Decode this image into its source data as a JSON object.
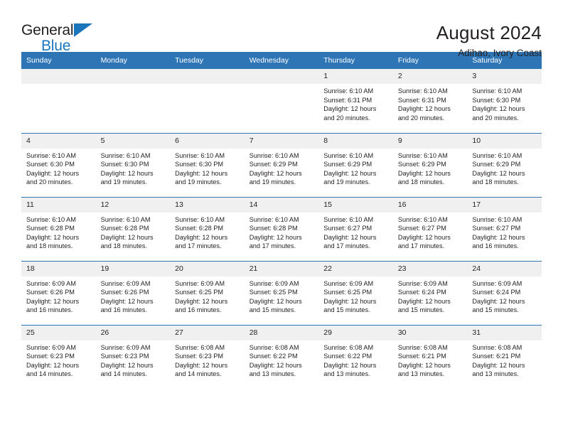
{
  "brand": {
    "name_part1": "General",
    "name_part2": "Blue",
    "triangle_icon": "triangle-icon",
    "accent_color": "#1b75bb"
  },
  "header": {
    "title": "August 2024",
    "location": "Adihao, Ivory Coast"
  },
  "calendar": {
    "header_bg": "#2e75b6",
    "daynum_bg": "#f0f0f0",
    "weekdays": [
      "Sunday",
      "Monday",
      "Tuesday",
      "Wednesday",
      "Thursday",
      "Friday",
      "Saturday"
    ],
    "labels": {
      "sunrise": "Sunrise:",
      "sunset": "Sunset:",
      "daylight": "Daylight:"
    },
    "weeks": [
      [
        {
          "day": "",
          "empty": true
        },
        {
          "day": "",
          "empty": true
        },
        {
          "day": "",
          "empty": true
        },
        {
          "day": "",
          "empty": true
        },
        {
          "day": "1",
          "sunrise": "Sunrise: 6:10 AM",
          "sunset": "Sunset: 6:31 PM",
          "daylight_1": "Daylight: 12 hours",
          "daylight_2": "and 20 minutes."
        },
        {
          "day": "2",
          "sunrise": "Sunrise: 6:10 AM",
          "sunset": "Sunset: 6:31 PM",
          "daylight_1": "Daylight: 12 hours",
          "daylight_2": "and 20 minutes."
        },
        {
          "day": "3",
          "sunrise": "Sunrise: 6:10 AM",
          "sunset": "Sunset: 6:30 PM",
          "daylight_1": "Daylight: 12 hours",
          "daylight_2": "and 20 minutes."
        }
      ],
      [
        {
          "day": "4",
          "sunrise": "Sunrise: 6:10 AM",
          "sunset": "Sunset: 6:30 PM",
          "daylight_1": "Daylight: 12 hours",
          "daylight_2": "and 20 minutes."
        },
        {
          "day": "5",
          "sunrise": "Sunrise: 6:10 AM",
          "sunset": "Sunset: 6:30 PM",
          "daylight_1": "Daylight: 12 hours",
          "daylight_2": "and 19 minutes."
        },
        {
          "day": "6",
          "sunrise": "Sunrise: 6:10 AM",
          "sunset": "Sunset: 6:30 PM",
          "daylight_1": "Daylight: 12 hours",
          "daylight_2": "and 19 minutes."
        },
        {
          "day": "7",
          "sunrise": "Sunrise: 6:10 AM",
          "sunset": "Sunset: 6:29 PM",
          "daylight_1": "Daylight: 12 hours",
          "daylight_2": "and 19 minutes."
        },
        {
          "day": "8",
          "sunrise": "Sunrise: 6:10 AM",
          "sunset": "Sunset: 6:29 PM",
          "daylight_1": "Daylight: 12 hours",
          "daylight_2": "and 19 minutes."
        },
        {
          "day": "9",
          "sunrise": "Sunrise: 6:10 AM",
          "sunset": "Sunset: 6:29 PM",
          "daylight_1": "Daylight: 12 hours",
          "daylight_2": "and 18 minutes."
        },
        {
          "day": "10",
          "sunrise": "Sunrise: 6:10 AM",
          "sunset": "Sunset: 6:29 PM",
          "daylight_1": "Daylight: 12 hours",
          "daylight_2": "and 18 minutes."
        }
      ],
      [
        {
          "day": "11",
          "sunrise": "Sunrise: 6:10 AM",
          "sunset": "Sunset: 6:28 PM",
          "daylight_1": "Daylight: 12 hours",
          "daylight_2": "and 18 minutes."
        },
        {
          "day": "12",
          "sunrise": "Sunrise: 6:10 AM",
          "sunset": "Sunset: 6:28 PM",
          "daylight_1": "Daylight: 12 hours",
          "daylight_2": "and 18 minutes."
        },
        {
          "day": "13",
          "sunrise": "Sunrise: 6:10 AM",
          "sunset": "Sunset: 6:28 PM",
          "daylight_1": "Daylight: 12 hours",
          "daylight_2": "and 17 minutes."
        },
        {
          "day": "14",
          "sunrise": "Sunrise: 6:10 AM",
          "sunset": "Sunset: 6:28 PM",
          "daylight_1": "Daylight: 12 hours",
          "daylight_2": "and 17 minutes."
        },
        {
          "day": "15",
          "sunrise": "Sunrise: 6:10 AM",
          "sunset": "Sunset: 6:27 PM",
          "daylight_1": "Daylight: 12 hours",
          "daylight_2": "and 17 minutes."
        },
        {
          "day": "16",
          "sunrise": "Sunrise: 6:10 AM",
          "sunset": "Sunset: 6:27 PM",
          "daylight_1": "Daylight: 12 hours",
          "daylight_2": "and 17 minutes."
        },
        {
          "day": "17",
          "sunrise": "Sunrise: 6:10 AM",
          "sunset": "Sunset: 6:27 PM",
          "daylight_1": "Daylight: 12 hours",
          "daylight_2": "and 16 minutes."
        }
      ],
      [
        {
          "day": "18",
          "sunrise": "Sunrise: 6:09 AM",
          "sunset": "Sunset: 6:26 PM",
          "daylight_1": "Daylight: 12 hours",
          "daylight_2": "and 16 minutes."
        },
        {
          "day": "19",
          "sunrise": "Sunrise: 6:09 AM",
          "sunset": "Sunset: 6:26 PM",
          "daylight_1": "Daylight: 12 hours",
          "daylight_2": "and 16 minutes."
        },
        {
          "day": "20",
          "sunrise": "Sunrise: 6:09 AM",
          "sunset": "Sunset: 6:25 PM",
          "daylight_1": "Daylight: 12 hours",
          "daylight_2": "and 16 minutes."
        },
        {
          "day": "21",
          "sunrise": "Sunrise: 6:09 AM",
          "sunset": "Sunset: 6:25 PM",
          "daylight_1": "Daylight: 12 hours",
          "daylight_2": "and 15 minutes."
        },
        {
          "day": "22",
          "sunrise": "Sunrise: 6:09 AM",
          "sunset": "Sunset: 6:25 PM",
          "daylight_1": "Daylight: 12 hours",
          "daylight_2": "and 15 minutes."
        },
        {
          "day": "23",
          "sunrise": "Sunrise: 6:09 AM",
          "sunset": "Sunset: 6:24 PM",
          "daylight_1": "Daylight: 12 hours",
          "daylight_2": "and 15 minutes."
        },
        {
          "day": "24",
          "sunrise": "Sunrise: 6:09 AM",
          "sunset": "Sunset: 6:24 PM",
          "daylight_1": "Daylight: 12 hours",
          "daylight_2": "and 15 minutes."
        }
      ],
      [
        {
          "day": "25",
          "sunrise": "Sunrise: 6:09 AM",
          "sunset": "Sunset: 6:23 PM",
          "daylight_1": "Daylight: 12 hours",
          "daylight_2": "and 14 minutes."
        },
        {
          "day": "26",
          "sunrise": "Sunrise: 6:09 AM",
          "sunset": "Sunset: 6:23 PM",
          "daylight_1": "Daylight: 12 hours",
          "daylight_2": "and 14 minutes."
        },
        {
          "day": "27",
          "sunrise": "Sunrise: 6:08 AM",
          "sunset": "Sunset: 6:23 PM",
          "daylight_1": "Daylight: 12 hours",
          "daylight_2": "and 14 minutes."
        },
        {
          "day": "28",
          "sunrise": "Sunrise: 6:08 AM",
          "sunset": "Sunset: 6:22 PM",
          "daylight_1": "Daylight: 12 hours",
          "daylight_2": "and 13 minutes."
        },
        {
          "day": "29",
          "sunrise": "Sunrise: 6:08 AM",
          "sunset": "Sunset: 6:22 PM",
          "daylight_1": "Daylight: 12 hours",
          "daylight_2": "and 13 minutes."
        },
        {
          "day": "30",
          "sunrise": "Sunrise: 6:08 AM",
          "sunset": "Sunset: 6:21 PM",
          "daylight_1": "Daylight: 12 hours",
          "daylight_2": "and 13 minutes."
        },
        {
          "day": "31",
          "sunrise": "Sunrise: 6:08 AM",
          "sunset": "Sunset: 6:21 PM",
          "daylight_1": "Daylight: 12 hours",
          "daylight_2": "and 13 minutes."
        }
      ]
    ]
  }
}
